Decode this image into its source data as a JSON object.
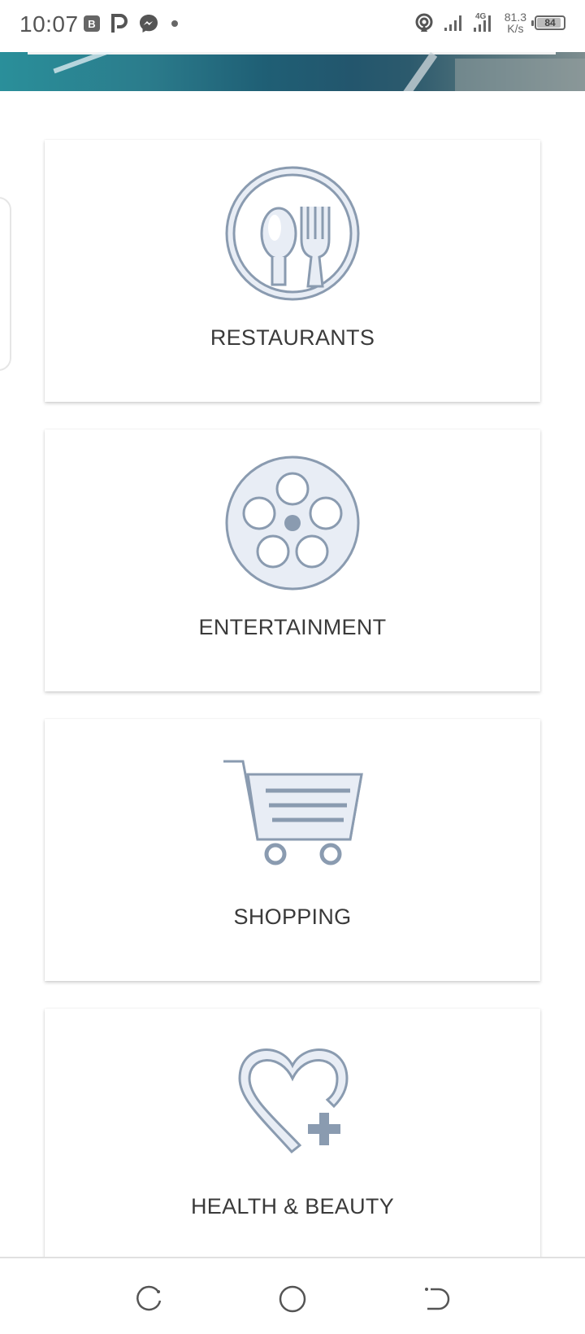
{
  "status_bar": {
    "time": "10:07",
    "network_speed_value": "81.3",
    "network_speed_unit": "K/s",
    "network_type": "4G",
    "battery_level": "84",
    "icons_left": [
      "b-icon",
      "p-icon",
      "messenger-icon",
      "dot-icon"
    ],
    "icons_right": [
      "hotspot-icon",
      "signal-icon",
      "signal-4g-icon",
      "battery-icon"
    ]
  },
  "categories": [
    {
      "label": "RESTAURANTS",
      "icon": "spoon-fork-icon"
    },
    {
      "label": "ENTERTAINMENT",
      "icon": "film-reel-icon"
    },
    {
      "label": "SHOPPING",
      "icon": "shopping-cart-icon"
    },
    {
      "label": "HEALTH & BEAUTY",
      "icon": "heart-plus-icon"
    }
  ],
  "nav_bar": {
    "buttons": [
      "recent-apps",
      "home",
      "back"
    ]
  },
  "colors": {
    "icon_stroke": "#8a9bb0",
    "icon_fill": "#e8edf5",
    "label_text": "#3a3a3a"
  }
}
